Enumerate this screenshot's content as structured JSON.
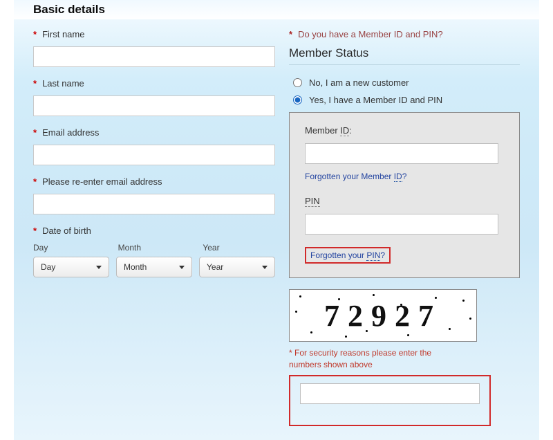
{
  "headings": {
    "basic": "Basic details",
    "member_status": "Member Status"
  },
  "left": {
    "first_name": "First name",
    "last_name": "Last name",
    "email": "Email address",
    "email_confirm": "Please re-enter email address",
    "dob": "Date of birth",
    "day_label": "Day",
    "month_label": "Month",
    "year_label": "Year",
    "day_ph": "Day",
    "month_ph": "Month",
    "year_ph": "Year"
  },
  "right": {
    "question": "Do you have a Member ID and PIN?",
    "opt_no": "No, I am a new customer",
    "opt_yes": "Yes, I have a Member ID and PIN",
    "member_id_label": "Member ID:",
    "forgot_id_pre": "Forgotten your Member ",
    "forgot_id_u": "ID",
    "forgot_id_q": "?",
    "pin_label": "PIN",
    "forgot_pin_pre": "Forgotten your ",
    "forgot_pin_u": "PIN",
    "forgot_pin_q": "?",
    "captcha_text": "72927",
    "security_hint": "* For security reasons please enter the numbers shown above"
  }
}
